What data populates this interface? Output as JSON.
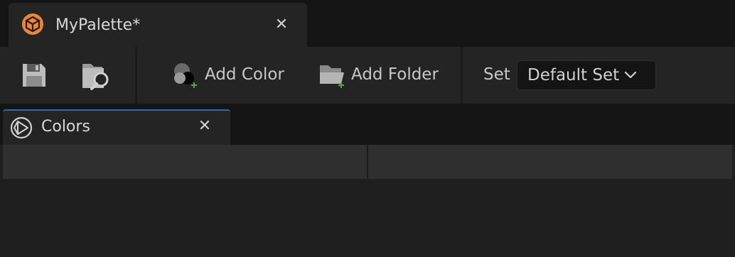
{
  "document_tab": {
    "title": "MyPalette*",
    "icon": "palette-asset-icon",
    "close_glyph": "✕"
  },
  "toolbar": {
    "save_icon": "save-icon",
    "browse_icon": "browse-to-asset-icon",
    "add_color_label": "Add Color",
    "add_folder_label": "Add Folder",
    "set_label": "Set",
    "set_value": "Default Set"
  },
  "panel_tab": {
    "title": "Colors",
    "icon": "colors-panel-icon",
    "close_glyph": "✕"
  },
  "colors": {
    "accent_orange": "#e8873a",
    "tab_active_border": "#2a6fb5",
    "add_badge_green": "#5aa63a"
  }
}
